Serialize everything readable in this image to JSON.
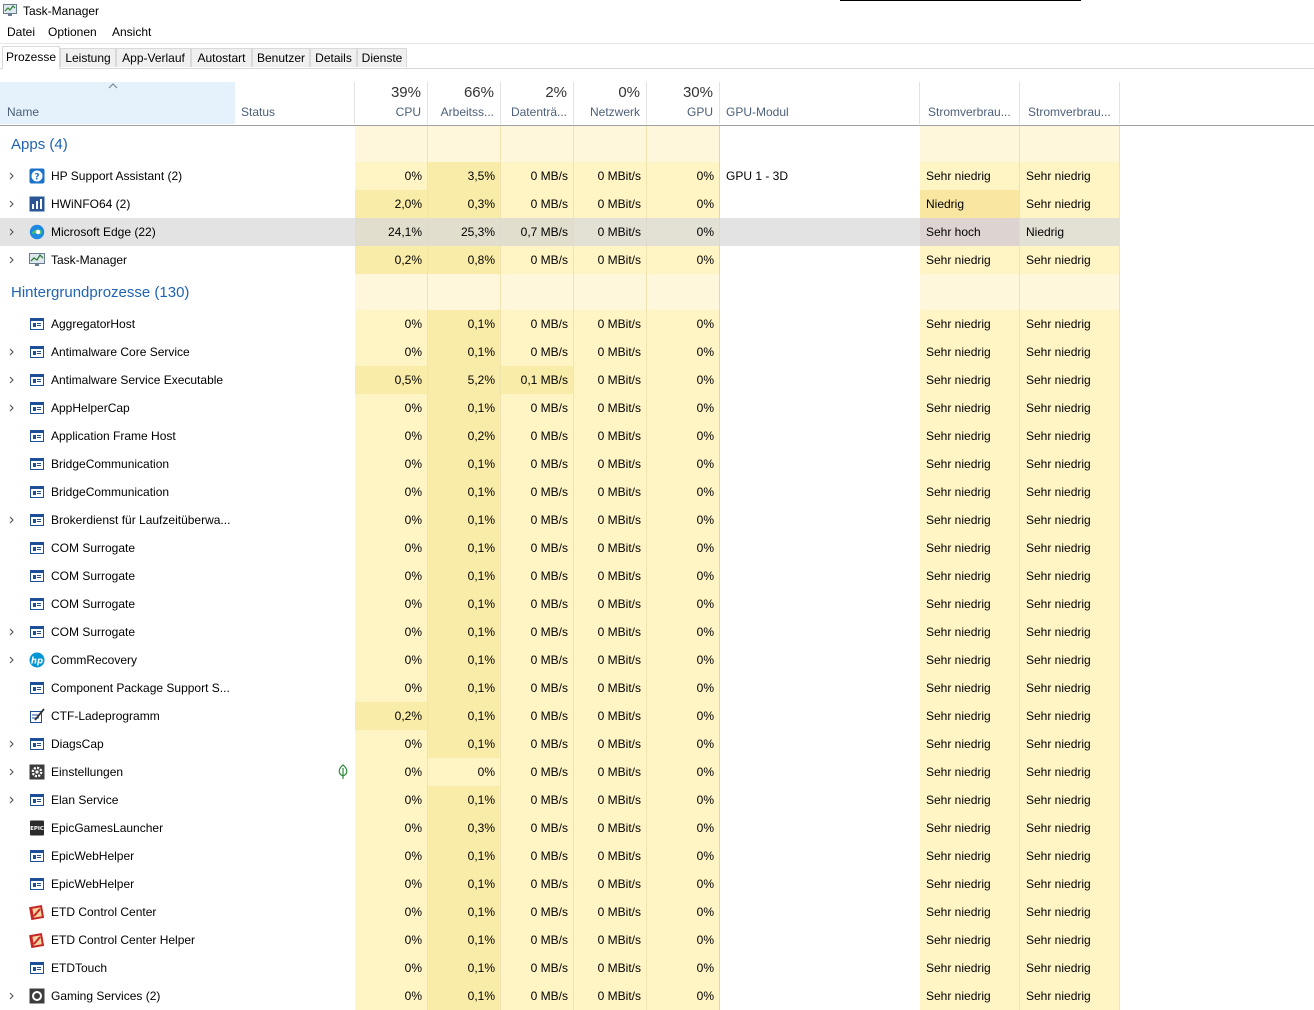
{
  "window": {
    "title": "Task-Manager"
  },
  "menu": [
    "Datei",
    "Optionen",
    "Ansicht"
  ],
  "tabs": [
    "Prozesse",
    "Leistung",
    "App-Verlauf",
    "Autostart",
    "Benutzer",
    "Details",
    "Dienste"
  ],
  "active_tab": "Prozesse",
  "columns": {
    "name": "Name",
    "status": "Status",
    "cpu": {
      "pct": "39%",
      "label": "CPU"
    },
    "mem": {
      "pct": "66%",
      "label": "Arbeitss..."
    },
    "disk": {
      "pct": "2%",
      "label": "Datenträ..."
    },
    "net": {
      "pct": "0%",
      "label": "Netzwerk"
    },
    "gpu": {
      "pct": "30%",
      "label": "GPU"
    },
    "gpu_engine": "GPU-Modul",
    "power": "Stromverbrau...",
    "power_trend": "Stromverbrau..."
  },
  "colors": {
    "heat_light": "#fff4c4",
    "heat_mid": "#f9eca8",
    "heat_group": "#fef7dc",
    "power_medium": "#f9e6a0",
    "power_high": "#e8c0b6",
    "selected": "#d9d9d9",
    "group_label": "#1e63b5"
  },
  "rows": [
    {
      "type": "group",
      "label": "Apps (4)"
    },
    {
      "type": "proc",
      "name": "HP Support Assistant (2)",
      "icon": "hp-support-icon",
      "expand": true,
      "status": "",
      "cpu": "0%",
      "mem": "3,5%",
      "disk": "0 MB/s",
      "net": "0 MBit/s",
      "gpu": "0%",
      "engine": "GPU 1 - 3D",
      "power": "Sehr niedrig",
      "trend": "Sehr niedrig"
    },
    {
      "type": "proc",
      "name": "HWiNFO64 (2)",
      "icon": "hwinfo-icon",
      "expand": true,
      "status": "",
      "cpu": "2,0%",
      "mem": "0,3%",
      "disk": "0 MB/s",
      "net": "0 MBit/s",
      "gpu": "0%",
      "engine": "",
      "power": "Niedrig",
      "trend": "Sehr niedrig",
      "power_level": "medium"
    },
    {
      "type": "proc",
      "name": "Microsoft Edge (22)",
      "icon": "edge-icon",
      "expand": true,
      "selected": true,
      "status": "",
      "cpu": "24,1%",
      "mem": "25,3%",
      "disk": "0,7 MB/s",
      "net": "0 MBit/s",
      "gpu": "0%",
      "engine": "",
      "power": "Sehr hoch",
      "trend": "Niedrig",
      "power_level": "high"
    },
    {
      "type": "proc",
      "name": "Task-Manager",
      "icon": "taskmanager-icon",
      "expand": true,
      "status": "",
      "cpu": "0,2%",
      "mem": "0,8%",
      "disk": "0 MB/s",
      "net": "0 MBit/s",
      "gpu": "0%",
      "engine": "",
      "power": "Sehr niedrig",
      "trend": "Sehr niedrig"
    },
    {
      "type": "group",
      "label": "Hintergrundprozesse (130)"
    },
    {
      "type": "proc",
      "name": "AggregatorHost",
      "icon": "window-icon",
      "expand": false,
      "status": "",
      "cpu": "0%",
      "mem": "0,1%",
      "disk": "0 MB/s",
      "net": "0 MBit/s",
      "gpu": "0%",
      "engine": "",
      "power": "Sehr niedrig",
      "trend": "Sehr niedrig"
    },
    {
      "type": "proc",
      "name": "Antimalware Core Service",
      "icon": "window-icon",
      "expand": true,
      "status": "",
      "cpu": "0%",
      "mem": "0,1%",
      "disk": "0 MB/s",
      "net": "0 MBit/s",
      "gpu": "0%",
      "engine": "",
      "power": "Sehr niedrig",
      "trend": "Sehr niedrig"
    },
    {
      "type": "proc",
      "name": "Antimalware Service Executable",
      "icon": "window-icon",
      "expand": true,
      "status": "",
      "cpu": "0,5%",
      "mem": "5,2%",
      "disk": "0,1 MB/s",
      "net": "0 MBit/s",
      "gpu": "0%",
      "engine": "",
      "power": "Sehr niedrig",
      "trend": "Sehr niedrig"
    },
    {
      "type": "proc",
      "name": "AppHelperCap",
      "icon": "window-icon",
      "expand": true,
      "status": "",
      "cpu": "0%",
      "mem": "0,1%",
      "disk": "0 MB/s",
      "net": "0 MBit/s",
      "gpu": "0%",
      "engine": "",
      "power": "Sehr niedrig",
      "trend": "Sehr niedrig"
    },
    {
      "type": "proc",
      "name": "Application Frame Host",
      "icon": "window-icon",
      "expand": false,
      "status": "",
      "cpu": "0%",
      "mem": "0,2%",
      "disk": "0 MB/s",
      "net": "0 MBit/s",
      "gpu": "0%",
      "engine": "",
      "power": "Sehr niedrig",
      "trend": "Sehr niedrig"
    },
    {
      "type": "proc",
      "name": "BridgeCommunication",
      "icon": "window-icon",
      "expand": false,
      "status": "",
      "cpu": "0%",
      "mem": "0,1%",
      "disk": "0 MB/s",
      "net": "0 MBit/s",
      "gpu": "0%",
      "engine": "",
      "power": "Sehr niedrig",
      "trend": "Sehr niedrig"
    },
    {
      "type": "proc",
      "name": "BridgeCommunication",
      "icon": "window-icon",
      "expand": false,
      "status": "",
      "cpu": "0%",
      "mem": "0,1%",
      "disk": "0 MB/s",
      "net": "0 MBit/s",
      "gpu": "0%",
      "engine": "",
      "power": "Sehr niedrig",
      "trend": "Sehr niedrig"
    },
    {
      "type": "proc",
      "name": "Brokerdienst für Laufzeitüberwa...",
      "icon": "window-icon",
      "expand": true,
      "status": "",
      "cpu": "0%",
      "mem": "0,1%",
      "disk": "0 MB/s",
      "net": "0 MBit/s",
      "gpu": "0%",
      "engine": "",
      "power": "Sehr niedrig",
      "trend": "Sehr niedrig"
    },
    {
      "type": "proc",
      "name": "COM Surrogate",
      "icon": "window-icon",
      "expand": false,
      "status": "",
      "cpu": "0%",
      "mem": "0,1%",
      "disk": "0 MB/s",
      "net": "0 MBit/s",
      "gpu": "0%",
      "engine": "",
      "power": "Sehr niedrig",
      "trend": "Sehr niedrig"
    },
    {
      "type": "proc",
      "name": "COM Surrogate",
      "icon": "window-icon",
      "expand": false,
      "status": "",
      "cpu": "0%",
      "mem": "0,1%",
      "disk": "0 MB/s",
      "net": "0 MBit/s",
      "gpu": "0%",
      "engine": "",
      "power": "Sehr niedrig",
      "trend": "Sehr niedrig"
    },
    {
      "type": "proc",
      "name": "COM Surrogate",
      "icon": "window-icon",
      "expand": false,
      "status": "",
      "cpu": "0%",
      "mem": "0,1%",
      "disk": "0 MB/s",
      "net": "0 MBit/s",
      "gpu": "0%",
      "engine": "",
      "power": "Sehr niedrig",
      "trend": "Sehr niedrig"
    },
    {
      "type": "proc",
      "name": "COM Surrogate",
      "icon": "window-icon",
      "expand": true,
      "status": "",
      "cpu": "0%",
      "mem": "0,1%",
      "disk": "0 MB/s",
      "net": "0 MBit/s",
      "gpu": "0%",
      "engine": "",
      "power": "Sehr niedrig",
      "trend": "Sehr niedrig"
    },
    {
      "type": "proc",
      "name": "CommRecovery",
      "icon": "hp-logo-icon",
      "expand": true,
      "status": "",
      "cpu": "0%",
      "mem": "0,1%",
      "disk": "0 MB/s",
      "net": "0 MBit/s",
      "gpu": "0%",
      "engine": "",
      "power": "Sehr niedrig",
      "trend": "Sehr niedrig"
    },
    {
      "type": "proc",
      "name": "Component Package Support S...",
      "icon": "window-icon",
      "expand": false,
      "status": "",
      "cpu": "0%",
      "mem": "0,1%",
      "disk": "0 MB/s",
      "net": "0 MBit/s",
      "gpu": "0%",
      "engine": "",
      "power": "Sehr niedrig",
      "trend": "Sehr niedrig"
    },
    {
      "type": "proc",
      "name": "CTF-Ladeprogramm",
      "icon": "pen-notepad-icon",
      "expand": false,
      "status": "",
      "cpu": "0,2%",
      "mem": "0,1%",
      "disk": "0 MB/s",
      "net": "0 MBit/s",
      "gpu": "0%",
      "engine": "",
      "power": "Sehr niedrig",
      "trend": "Sehr niedrig"
    },
    {
      "type": "proc",
      "name": "DiagsCap",
      "icon": "window-icon",
      "expand": true,
      "status": "",
      "cpu": "0%",
      "mem": "0,1%",
      "disk": "0 MB/s",
      "net": "0 MBit/s",
      "gpu": "0%",
      "engine": "",
      "power": "Sehr niedrig",
      "trend": "Sehr niedrig"
    },
    {
      "type": "proc",
      "name": "Einstellungen",
      "icon": "gear-icon",
      "expand": true,
      "status_icon": "leaf-icon",
      "status": "",
      "cpu": "0%",
      "mem": "0%",
      "disk": "0 MB/s",
      "net": "0 MBit/s",
      "gpu": "0%",
      "engine": "",
      "power": "Sehr niedrig",
      "trend": "Sehr niedrig"
    },
    {
      "type": "proc",
      "name": "Elan Service",
      "icon": "window-icon",
      "expand": true,
      "status": "",
      "cpu": "0%",
      "mem": "0,1%",
      "disk": "0 MB/s",
      "net": "0 MBit/s",
      "gpu": "0%",
      "engine": "",
      "power": "Sehr niedrig",
      "trend": "Sehr niedrig"
    },
    {
      "type": "proc",
      "name": "EpicGamesLauncher",
      "icon": "epic-icon",
      "expand": false,
      "status": "",
      "cpu": "0%",
      "mem": "0,3%",
      "disk": "0 MB/s",
      "net": "0 MBit/s",
      "gpu": "0%",
      "engine": "",
      "power": "Sehr niedrig",
      "trend": "Sehr niedrig"
    },
    {
      "type": "proc",
      "name": "EpicWebHelper",
      "icon": "window-icon",
      "expand": false,
      "status": "",
      "cpu": "0%",
      "mem": "0,1%",
      "disk": "0 MB/s",
      "net": "0 MBit/s",
      "gpu": "0%",
      "engine": "",
      "power": "Sehr niedrig",
      "trend": "Sehr niedrig"
    },
    {
      "type": "proc",
      "name": "EpicWebHelper",
      "icon": "window-icon",
      "expand": false,
      "status": "",
      "cpu": "0%",
      "mem": "0,1%",
      "disk": "0 MB/s",
      "net": "0 MBit/s",
      "gpu": "0%",
      "engine": "",
      "power": "Sehr niedrig",
      "trend": "Sehr niedrig"
    },
    {
      "type": "proc",
      "name": "ETD Control Center",
      "icon": "etd-icon",
      "expand": false,
      "status": "",
      "cpu": "0%",
      "mem": "0,1%",
      "disk": "0 MB/s",
      "net": "0 MBit/s",
      "gpu": "0%",
      "engine": "",
      "power": "Sehr niedrig",
      "trend": "Sehr niedrig"
    },
    {
      "type": "proc",
      "name": "ETD Control Center Helper",
      "icon": "etd-icon",
      "expand": false,
      "status": "",
      "cpu": "0%",
      "mem": "0,1%",
      "disk": "0 MB/s",
      "net": "0 MBit/s",
      "gpu": "0%",
      "engine": "",
      "power": "Sehr niedrig",
      "trend": "Sehr niedrig"
    },
    {
      "type": "proc",
      "name": "ETDTouch",
      "icon": "window-icon",
      "expand": false,
      "status": "",
      "cpu": "0%",
      "mem": "0,1%",
      "disk": "0 MB/s",
      "net": "0 MBit/s",
      "gpu": "0%",
      "engine": "",
      "power": "Sehr niedrig",
      "trend": "Sehr niedrig"
    },
    {
      "type": "proc",
      "name": "Gaming Services (2)",
      "icon": "gaming-icon",
      "expand": true,
      "status": "",
      "cpu": "0%",
      "mem": "0,1%",
      "disk": "0 MB/s",
      "net": "0 MBit/s",
      "gpu": "0%",
      "engine": "",
      "power": "Sehr niedrig",
      "trend": "Sehr niedrig"
    }
  ]
}
